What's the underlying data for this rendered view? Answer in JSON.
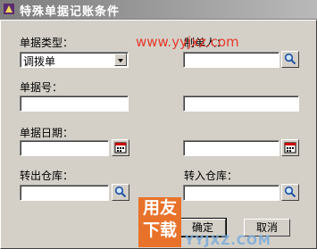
{
  "window": {
    "title": "特殊单据记账条件"
  },
  "fields": {
    "doc_type_label": "单据类型：",
    "doc_type_value": "调拨单",
    "maker_label": "制单人：",
    "doc_no_label": "单据号：",
    "doc_date_label": "单据日期：",
    "out_warehouse_label": "转出仓库：",
    "in_warehouse_label": "转入仓库："
  },
  "buttons": {
    "ok": "确定",
    "cancel": "取消"
  },
  "watermark": {
    "url": "www.yyjxz.com",
    "logo_top": "用友",
    "logo_bottom": "下载",
    "site": "YYJXZ.COM"
  }
}
